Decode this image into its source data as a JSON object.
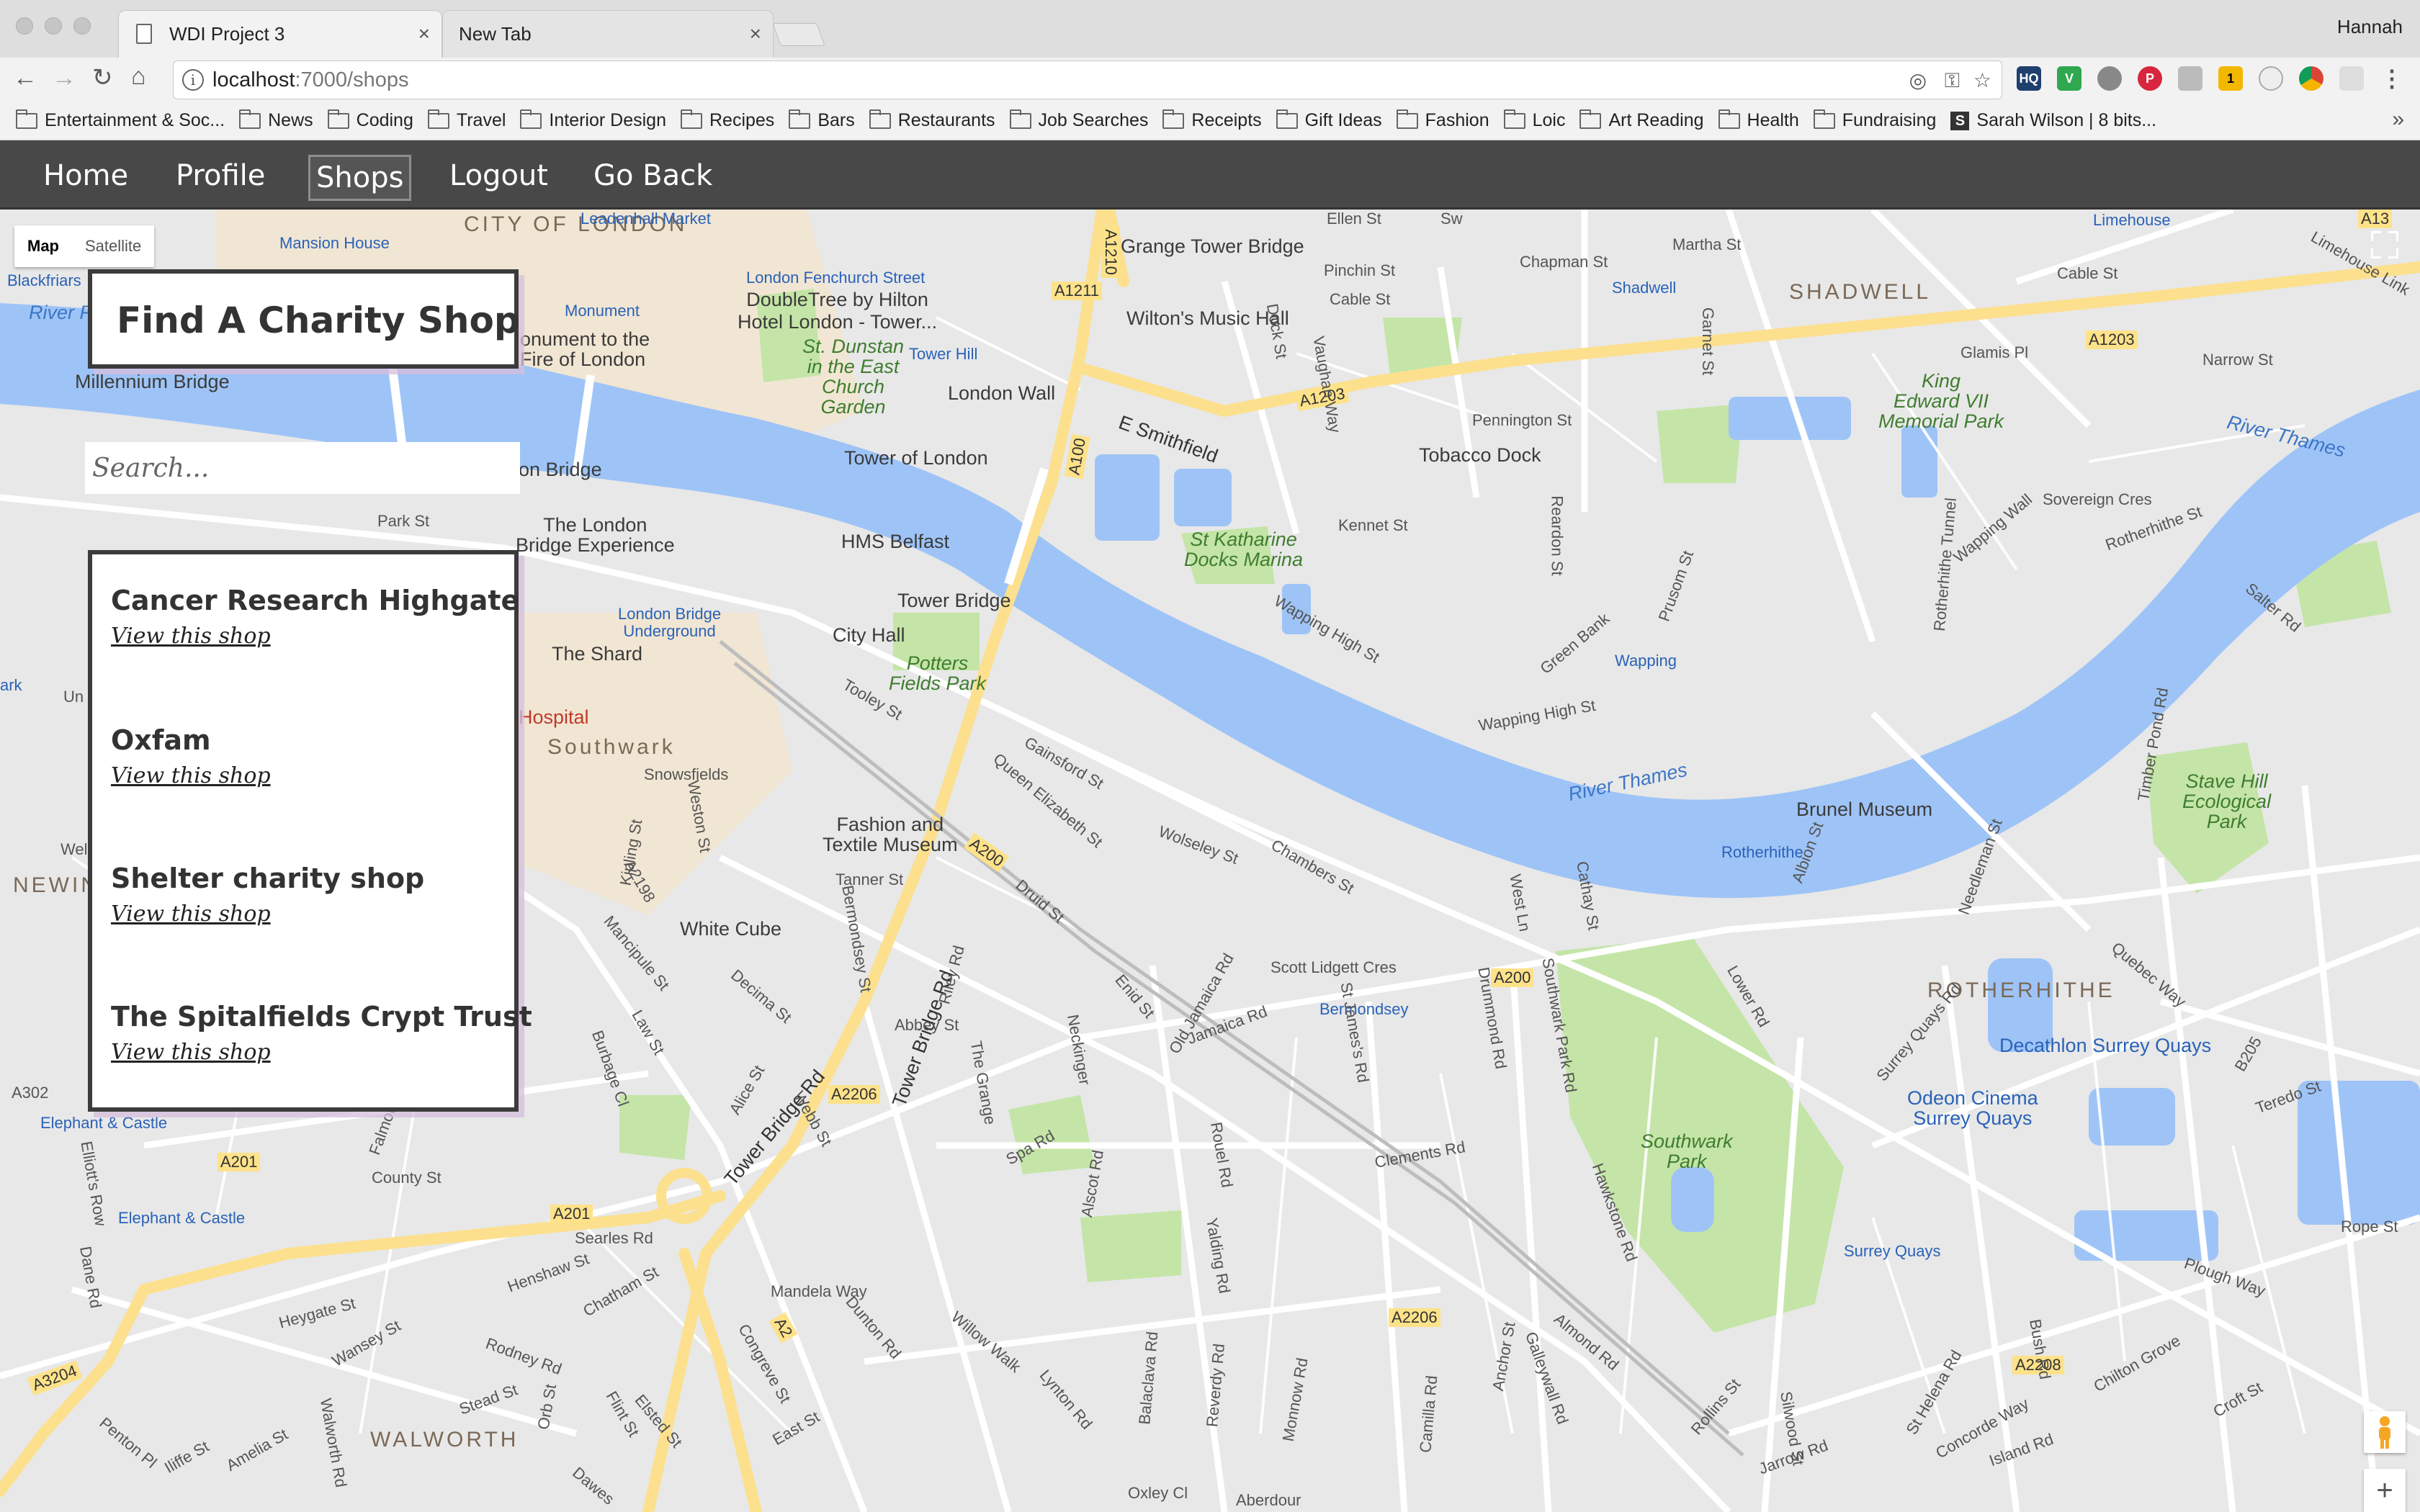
{
  "browser": {
    "tabs": [
      {
        "title": "WDI Project 3",
        "active": true
      },
      {
        "title": "New Tab",
        "active": false
      }
    ],
    "user": "Hannah",
    "url_host": "localhost",
    "url_rest": ":7000/shops",
    "bookmarks": [
      "Entertainment & Soc...",
      "News",
      "Coding",
      "Travel",
      "Interior Design",
      "Recipes",
      "Bars",
      "Restaurants",
      "Job Searches",
      "Receipts",
      "Gift Ideas",
      "Fashion",
      "Loic",
      "Art Reading",
      "Health",
      "Fundraising"
    ],
    "bookmark_special": "Sarah Wilson | 8 bits...",
    "more_bookmarks": "»",
    "extension_badge": "1"
  },
  "sitenav": {
    "home": "Home",
    "profile": "Profile",
    "shops": "Shops",
    "logout": "Logout",
    "back": "Go Back"
  },
  "page": {
    "title": "Find A Charity Shop",
    "search_placeholder": "Search...",
    "shops": [
      {
        "name": "Cancer Research Highgate",
        "link": "View this shop"
      },
      {
        "name": "Oxfam",
        "link": "View this shop"
      },
      {
        "name": "Shelter charity shop",
        "link": "View this shop"
      },
      {
        "name": "The Spitalfields Crypt Trust",
        "link": "View this shop"
      }
    ]
  },
  "map": {
    "type_map": "Map",
    "type_satellite": "Satellite",
    "zoom_in": "+",
    "colors": {
      "water": "#9ec4f7",
      "land": "#e8e8e8",
      "park": "#c4e5a7",
      "major_road": "#fce08e",
      "minor_road": "#ffffff"
    },
    "labels": {
      "city_of_london": "CITY OF\nLONDON",
      "shadwell_district": "SHADWELL",
      "southwark": "Southwark",
      "rotherhithe": "ROTHERHITHE",
      "walworth": "WALWORTH",
      "newington": "NEWIN",
      "river_thames_1": "River Thames",
      "river_thames_2": "River Thames",
      "river_fleet": "River Fl",
      "leadenhall": "Leadenhall Market",
      "mansion_house": "Mansion House",
      "monument": "Monument",
      "fenchurch": "London Fenchurch Street",
      "doubletree": "DoubleTree by Hilton\nHotel London - Tower...",
      "grange_tower_bridge": "Grange Tower Bridge",
      "wiltons": "Wilton's Music Hall",
      "st_dunstan": "St. Dunstan\nin the East\nChurch\nGarden",
      "tower_hill": "Tower Hill",
      "london_wall": "London Wall",
      "tower_of_london": "Tower of London",
      "monument_fire": "onument to the\nFire of London",
      "millennium": "Millennium Bridge",
      "blackfriars": "Blackfriars",
      "london_bridge": "on Bridge",
      "london_bridge_exp": "The London\nBridge Experience",
      "london_bridge_ug": "London Bridge\nUnderground",
      "hms_belfast": "HMS Belfast",
      "tower_bridge": "Tower Bridge",
      "city_hall": "City Hall",
      "shard": "The Shard",
      "potters_fields": "Potters\nFields Park",
      "hospital": "Hospital",
      "st_katharine": "St Katharine\nDocks Marina",
      "tobacco_dock": "Tobacco Dock",
      "king_edward": "King\nEdward VII\nMemorial Park",
      "shadwell_station": "Shadwell",
      "limehouse": "Limehouse",
      "limehouse_link": "Limehouse Link",
      "wapping": "Wapping",
      "brunel": "Brunel Museum",
      "rotherhithe_station": "Rotherhithe",
      "stave_hill": "Stave Hill\nEcological\nPark",
      "fashion_textile": "Fashion and\nTextile Museum",
      "white_cube": "White Cube",
      "bermondsey": "Bermondsey",
      "decathlon": "Decathlon Surrey Quays",
      "odeon": "Odeon Cinema\nSurrey Quays",
      "southwark_park": "Southwark\nPark",
      "surrey_quays": "Surrey Quays",
      "elephant_castle_1": "Elephant & Castle",
      "elephant_castle_2": "Elephant & Castle",
      "a1210": "A1210",
      "a1211": "A1211",
      "a1203": "A1203",
      "a1203b": "A1203",
      "a13": "A13",
      "a100": "A100",
      "a200": "A200",
      "a200b": "A200",
      "a2206": "A2206",
      "a2206b": "A2206",
      "a201": "A201",
      "a201b": "A201",
      "a2": "A2",
      "a2208": "A2208",
      "a3204": "A3204",
      "a302": "A302",
      "a2198": "A2198",
      "b205": "B205",
      "tower_bridge_rd": "Tower Bridge Rd",
      "tower_bridge_rd2": "Tower Bridge Rd",
      "e_smithfield": "E Smithfield",
      "chapman_st": "Chapman St",
      "cable_st": "Cable St",
      "cable_st2": "Cable St",
      "martha_st": "Martha St",
      "narrow_st": "Narrow St",
      "pennington_st": "Pennington St",
      "wapping_high_st": "Wapping High St",
      "wapping_high_st2": "Wapping High St",
      "wapping_wall": "Wapping Wall",
      "scott_lidgett": "Scott Lidgett Cres",
      "clements_rd": "Clements Rd",
      "lower_rd": "Lower Rd",
      "jamaica_rd": "Jamaica Rd",
      "abbey_st": "Abbey St",
      "druid_st": "Druid St",
      "tooley_st": "Tooley St",
      "spa_rd": "Spa Rd",
      "county_st": "County St",
      "searles_rd": "Searles Rd",
      "mandela_way": "Mandela Way",
      "heygate_st": "Heygate St",
      "rodney_rd": "Rodney Rd",
      "snowsfields": "Snowsfields",
      "chambers_st": "Chambers St",
      "wolseley_st": "Wolseley St",
      "gainsford_st": "Gainsford St",
      "queen_elizabeth_st": "Queen Elizabeth St",
      "sovereign_cres": "Sovereign Cres",
      "rotherhithe_st": "Rotherhithe St",
      "salter_rd": "Salter Rd",
      "park_st": "Park St",
      "tanner_st": "Tanner St",
      "jamaica_rd_b": "Rotherhithe Tunnel",
      "ellen_st": "Ellen St",
      "pinchin_st": "Pinchin St",
      "glamis_pl": "Glamis Pl",
      "kennet_st": "Kennet St",
      "green_bank": "Green Bank",
      "prusom_st": "Prusom St",
      "reardon_st": "Reardon St",
      "garnet_st": "Garnet St",
      "vaughan_way": "Vaughan Way",
      "dock_st": "Dock St",
      "albion_st": "Albion St",
      "timber_pond": "Timber Pond Rd",
      "quebec_way": "Quebec Way",
      "surrey_quays_rd": "Surrey Quays Rd",
      "needleman_st": "Needleman St",
      "plough_way": "Plough Way",
      "chilton_grove": "Chilton Grove",
      "rope_st": "Rope St",
      "teredo_st": "Teredo St",
      "croft_st": "Croft St",
      "concorde_way": "Concorde Way",
      "island_rd": "Island Rd",
      "jarrow_rd": "Jarrow Rd",
      "oxley_cl": "Oxley Cl",
      "willow_walk": "Willow Walk",
      "lynton_rd": "Lynton Rd",
      "monnow_rd": "Monnow Rd",
      "balaclava_rd": "Balaclava Rd",
      "reverdy_rd": "Reverdy Rd",
      "yalding_rd": "Yalding Rd",
      "alscot_rd": "Alscot Rd",
      "the_grange": "The Grange",
      "riley_rd": "Riley Rd",
      "neckinger": "Neckinger",
      "enid_st": "Enid St",
      "old_jamaica": "Old Jamaica Rd",
      "st_james_rd": "St James's Rd",
      "drummond_rd": "Drummond Rd",
      "southwark_park_rd": "Southwark Park Rd",
      "west_ln": "West Ln",
      "cathay_st": "Cathay St",
      "hawkstone": "Hawkstone Rd",
      "galleywall_rd": "Galleywall Rd",
      "almond_rd": "Almond Rd",
      "camilla_rd": "Camilla Rd",
      "silwood_st": "Silwood St",
      "rollins_st": "Rollins St",
      "bush_rd": "Bush Rd",
      "st_helena_rd": "St Helena Rd",
      "anchor_st": "Anchor St",
      "rouel_rd": "Rouel Rd",
      "bermondsey_st": "Bermondsey St",
      "weston_st": "Weston St",
      "kipling_st": "Kipling St",
      "mancipule_st": "Mancipule St",
      "law_st": "Law St",
      "decima_st": "Decima St",
      "alice_st": "Alice St",
      "webb_st": "Webb St",
      "burbage_cl": "Burbage Cl",
      "falmouth_rd": "Falmouth Rd",
      "chatham_st": "Chatham St",
      "henshaw_st": "Henshaw St",
      "wansey_st": "Wansey St",
      "stead_st": "Stead St",
      "orb_st": "Orb St",
      "flint_st": "Flint St",
      "elsted_st": "Elsted St",
      "east_st": "East St",
      "congreve_st": "Congreve St",
      "dunton_rd": "Dunton Rd",
      "dane_rd": "Dane Rd",
      "elliotts_row": "Elliott's Row",
      "penton_pl": "Penton Pl",
      "amelia_st": "Amelia St",
      "iliffe_st": "Iliffe St",
      "walworth_rd": "Walworth Rd",
      "dawes": "Dawes",
      "aberdour": "Aberdour",
      "swan": "Sw",
      "wei": "Wel",
      "un": "Un",
      "ark": "ark"
    }
  }
}
